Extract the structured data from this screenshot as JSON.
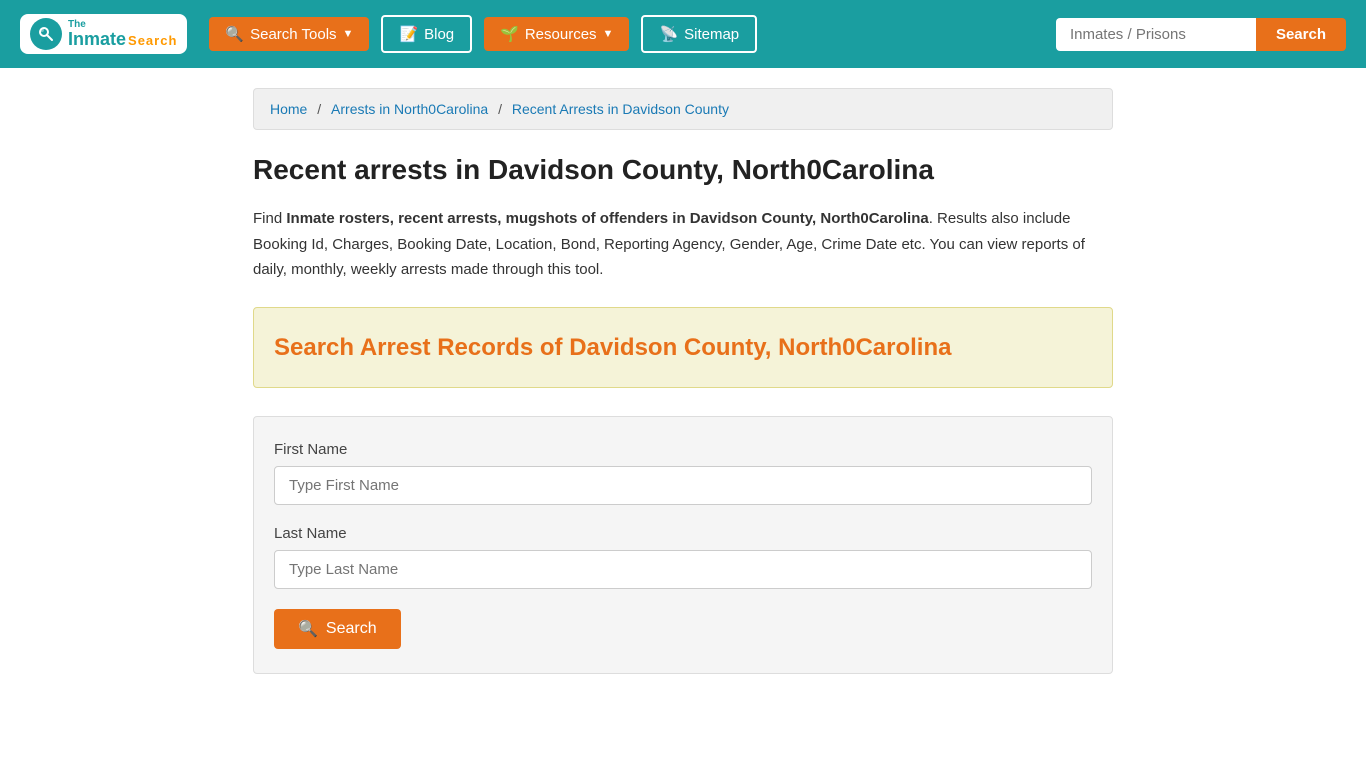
{
  "header": {
    "logo": {
      "the": "The",
      "inmate": "Inmate",
      "search": "Search"
    },
    "nav": [
      {
        "id": "search-tools",
        "label": "Search Tools",
        "icon": "🔍",
        "hasDropdown": true
      },
      {
        "id": "blog",
        "label": "Blog",
        "icon": "📝",
        "hasDropdown": false
      },
      {
        "id": "resources",
        "label": "Resources",
        "icon": "🌱",
        "hasDropdown": true
      },
      {
        "id": "sitemap",
        "label": "Sitemap",
        "icon": "📡",
        "hasDropdown": false
      }
    ],
    "search": {
      "placeholder": "Inmates / Prisons",
      "button_label": "Search"
    }
  },
  "breadcrumb": {
    "items": [
      {
        "label": "Home",
        "href": "#"
      },
      {
        "label": "Arrests in North0Carolina",
        "href": "#"
      },
      {
        "label": "Recent Arrests in Davidson County",
        "href": "#"
      }
    ]
  },
  "page": {
    "title": "Recent arrests in Davidson County, North0Carolina",
    "description_intro": "Find ",
    "description_bold": "Inmate rosters, recent arrests, mugshots of offenders in Davidson County, North0Carolina",
    "description_rest": ". Results also include Booking Id, Charges, Booking Date, Location, Bond, Reporting Agency, Gender, Age, Crime Date etc. You can view reports of daily, monthly, weekly arrests made through this tool.",
    "search_records_title": "Search Arrest Records of Davidson County, North0Carolina"
  },
  "search_form": {
    "first_name_label": "First Name",
    "first_name_placeholder": "Type First Name",
    "last_name_label": "Last Name",
    "last_name_placeholder": "Type Last Name",
    "submit_label": "Search",
    "submit_icon": "🔍"
  },
  "colors": {
    "teal": "#1a9ea0",
    "orange": "#e8701a",
    "link_blue": "#1a7ab5"
  }
}
